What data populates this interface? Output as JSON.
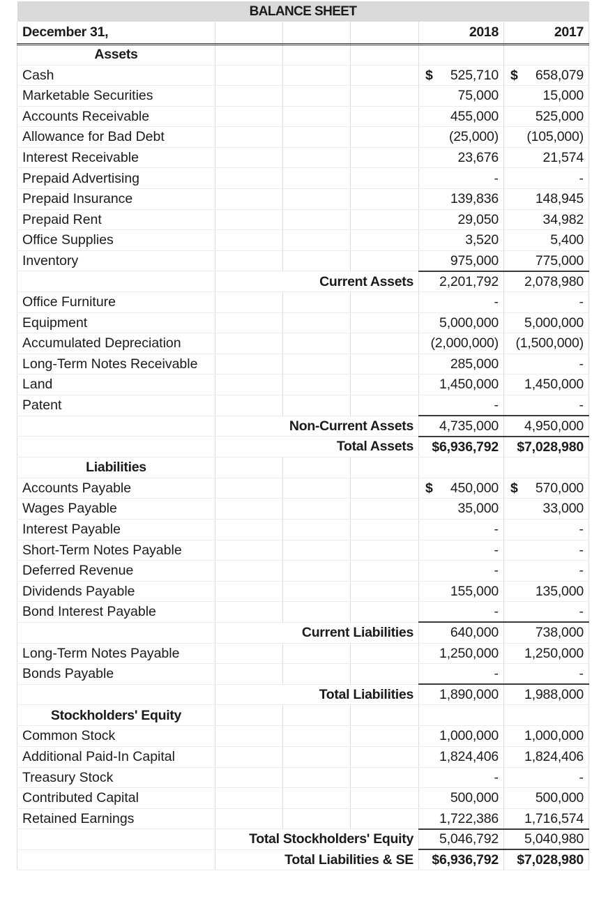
{
  "report": {
    "title": "BALANCE SHEET",
    "date_label": "December 31,",
    "year_headers": [
      "2018",
      "2017"
    ],
    "zero_placeholder": "-",
    "currency_symbol": "$",
    "accent_rule_color": "#3a3a3a",
    "title_band_color": "#d9d9d9"
  },
  "sections": {
    "assets": {
      "heading": "Assets",
      "current_items": [
        {
          "label": "Cash",
          "indent": false,
          "y2018": "525,710",
          "y2017": "658,079",
          "dollar": true
        },
        {
          "label": "Marketable Securities",
          "indent": false,
          "y2018": "75,000",
          "y2017": "15,000",
          "dollar": false
        },
        {
          "label": "Accounts Receivable",
          "indent": false,
          "y2018": "455,000",
          "y2017": "525,000",
          "dollar": false
        },
        {
          "label": "Allowance for Bad Debt",
          "indent": true,
          "y2018": "(25,000)",
          "y2017": "(105,000)",
          "dollar": false
        },
        {
          "label": "Interest Receivable",
          "indent": false,
          "y2018": "23,676",
          "y2017": "21,574",
          "dollar": false
        },
        {
          "label": "Prepaid Advertising",
          "indent": false,
          "y2018": "-",
          "y2017": "-",
          "dollar": false
        },
        {
          "label": "Prepaid Insurance",
          "indent": false,
          "y2018": "139,836",
          "y2017": "148,945",
          "dollar": false
        },
        {
          "label": "Prepaid Rent",
          "indent": false,
          "y2018": "29,050",
          "y2017": "34,982",
          "dollar": false
        },
        {
          "label": "Office Supplies",
          "indent": false,
          "y2018": "3,520",
          "y2017": "5,400",
          "dollar": false
        },
        {
          "label": "Inventory",
          "indent": false,
          "y2018": "975,000",
          "y2017": "775,000",
          "dollar": false
        }
      ],
      "current_total": {
        "label": "Current Assets",
        "y2018": "2,201,792",
        "y2017": "2,078,980"
      },
      "noncurrent_items": [
        {
          "label": "Office Furniture",
          "indent": false,
          "y2018": "-",
          "y2017": "-",
          "dollar": false
        },
        {
          "label": "Equipment",
          "indent": false,
          "y2018": "5,000,000",
          "y2017": "5,000,000",
          "dollar": false
        },
        {
          "label": "Accumulated Depreciation",
          "indent": true,
          "y2018": "(2,000,000)",
          "y2017": "(1,500,000)",
          "dollar": false
        },
        {
          "label": "Long-Term Notes Receivable",
          "indent": false,
          "y2018": "285,000",
          "y2017": "-",
          "dollar": false
        },
        {
          "label": "Land",
          "indent": false,
          "y2018": "1,450,000",
          "y2017": "1,450,000",
          "dollar": false
        },
        {
          "label": "Patent",
          "indent": false,
          "y2018": "-",
          "y2017": "-",
          "dollar": false
        }
      ],
      "noncurrent_total": {
        "label": "Non-Current Assets",
        "y2018": "4,735,000",
        "y2017": "4,950,000"
      },
      "grand_total": {
        "label": "Total Assets",
        "y2018": "$6,936,792",
        "y2017": "$7,028,980"
      }
    },
    "liabilities": {
      "heading": "Liabilities",
      "current_items": [
        {
          "label": "Accounts Payable",
          "indent": false,
          "y2018": "450,000",
          "y2017": "570,000",
          "dollar": true
        },
        {
          "label": "Wages Payable",
          "indent": false,
          "y2018": "35,000",
          "y2017": "33,000",
          "dollar": false
        },
        {
          "label": "Interest Payable",
          "indent": false,
          "y2018": "-",
          "y2017": "-",
          "dollar": false
        },
        {
          "label": "Short-Term Notes Payable",
          "indent": false,
          "y2018": "-",
          "y2017": "-",
          "dollar": false
        },
        {
          "label": "Deferred Revenue",
          "indent": false,
          "y2018": "-",
          "y2017": "-",
          "dollar": false
        },
        {
          "label": "Dividends Payable",
          "indent": false,
          "y2018": "155,000",
          "y2017": "135,000",
          "dollar": false
        },
        {
          "label": "Bond Interest Payable",
          "indent": false,
          "y2018": "-",
          "y2017": "-",
          "dollar": false
        }
      ],
      "current_total": {
        "label": "Current Liabilities",
        "y2018": "640,000",
        "y2017": "738,000"
      },
      "noncurrent_items": [
        {
          "label": "Long-Term Notes Payable",
          "indent": false,
          "y2018": "1,250,000",
          "y2017": "1,250,000",
          "dollar": false
        },
        {
          "label": "Bonds Payable",
          "indent": false,
          "y2018": "-",
          "y2017": "-",
          "dollar": false
        }
      ],
      "grand_total": {
        "label": "Total Liabilities",
        "y2018": "1,890,000",
        "y2017": "1,988,000"
      }
    },
    "equity": {
      "heading": "Stockholders' Equity",
      "items": [
        {
          "label": "Common Stock",
          "indent": false,
          "y2018": "1,000,000",
          "y2017": "1,000,000",
          "dollar": false
        },
        {
          "label": "Additional Paid-In Capital",
          "indent": false,
          "y2018": "1,824,406",
          "y2017": "1,824,406",
          "dollar": false
        },
        {
          "label": "Treasury Stock",
          "indent": true,
          "y2018": "-",
          "y2017": "-",
          "dollar": false
        },
        {
          "label": "Contributed Capital",
          "indent": false,
          "y2018": "500,000",
          "y2017": "500,000",
          "dollar": false
        },
        {
          "label": "Retained Earnings",
          "indent": false,
          "y2018": "1,722,386",
          "y2017": "1,716,574",
          "dollar": false
        }
      ],
      "total": {
        "label": "Total Stockholders' Equity",
        "y2018": "5,046,792",
        "y2017": "5,040,980"
      },
      "grand_total": {
        "label": "Total Liabilities & SE",
        "y2018": "$6,936,792",
        "y2017": "$7,028,980"
      }
    }
  }
}
